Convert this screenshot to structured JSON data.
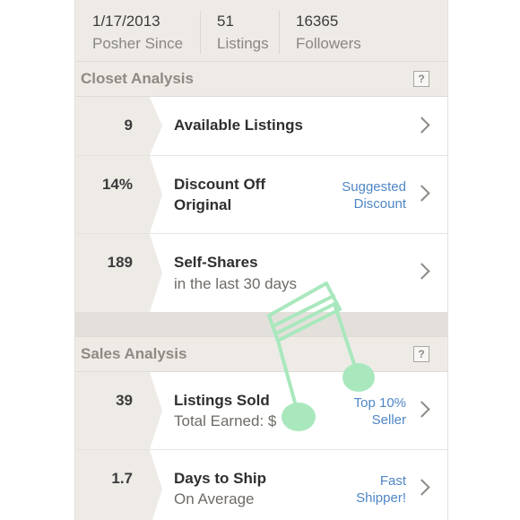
{
  "stats": [
    {
      "value": "1/17/2013",
      "label": "Posher Since"
    },
    {
      "value": "51",
      "label": "Listings"
    },
    {
      "value": "16365",
      "label": "Followers"
    }
  ],
  "closet": {
    "title": "Closet Analysis",
    "help": "?",
    "rows": [
      {
        "num": "9",
        "title": "Available Listings"
      },
      {
        "num": "14%",
        "title_line1": "Discount Off",
        "title_line2": "Original",
        "badge_line1": "Suggested",
        "badge_line2": "Discount"
      },
      {
        "num": "189",
        "title": "Self-Shares",
        "sub": "in the last 30 days"
      }
    ]
  },
  "sales": {
    "title": "Sales Analysis",
    "help": "?",
    "rows": [
      {
        "num": "39",
        "title": "Listings Sold",
        "sub": "Total Earned: $",
        "badge_line1": "Top 10%",
        "badge_line2": "Seller"
      },
      {
        "num": "1.7",
        "title": "Days to Ship",
        "sub": "On Average",
        "badge_line1": "Fast",
        "badge_line2": "Shipper!"
      }
    ]
  },
  "colors": {
    "accent_link": "#4f86c6",
    "doodle": "#a9e8bd"
  },
  "icons": {
    "chevron": "chevron-right-icon",
    "help": "help-icon",
    "doodle": "music-note-icon"
  }
}
